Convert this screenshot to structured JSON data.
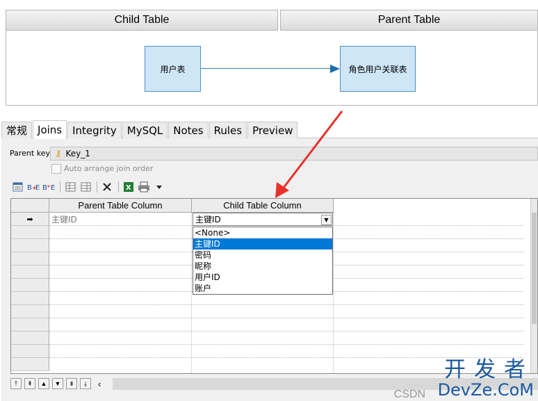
{
  "headers": {
    "child": "Child Table",
    "parent": "Parent Table"
  },
  "diagram": {
    "child_entity": "用户表",
    "parent_entity": "角色用户关联表"
  },
  "tabs": [
    "常规",
    "Joins",
    "Integrity",
    "MySQL",
    "Notes",
    "Rules",
    "Preview"
  ],
  "active_tab": "Joins",
  "parent_key": {
    "label": "Parent key:",
    "value": "Key_1"
  },
  "auto_arrange": {
    "label": "Auto arrange join order",
    "checked": false
  },
  "grid": {
    "columns": [
      "Parent Table Column",
      "Child Table Column"
    ],
    "rows": [
      {
        "parent": "主键ID",
        "child": "主键ID"
      }
    ],
    "current_row_marker": "➡"
  },
  "dropdown": {
    "options": [
      "<None>",
      "主键ID",
      "密码",
      "昵称",
      "用户ID",
      "账户"
    ],
    "selected": "主键ID"
  },
  "watermark": {
    "cn": "开发者",
    "en": "DevZe.CoM",
    "site": "CSDN"
  },
  "colors": {
    "entity_fill": "#cfe6f7",
    "selection": "#0078d7",
    "annotation_arrow": "#e8312a",
    "watermark": "#1a5aa0"
  }
}
